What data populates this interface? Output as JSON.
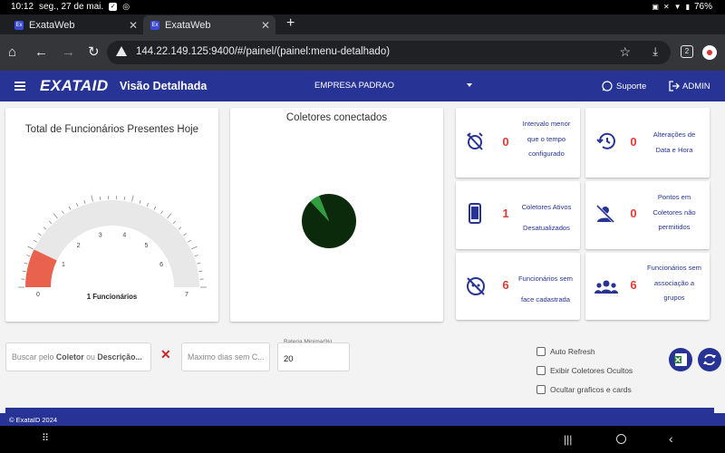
{
  "status": {
    "time": "10:12",
    "date": "seg., 27 de mai.",
    "battery": "76%"
  },
  "tabs": [
    {
      "label": "ExataWeb",
      "favicon": "Ex"
    },
    {
      "label": "ExataWeb",
      "favicon": "Ex"
    }
  ],
  "browser": {
    "url": "144.22.149.125:9400/#/painel/(painel:menu-detalhado)",
    "tab_count": "2"
  },
  "header": {
    "logo": "EXATAID",
    "title": "Visão Detalhada",
    "company": "EMPRESA PADRAO",
    "support_label": "Suporte",
    "admin_label": "ADMIN"
  },
  "gauge": {
    "title": "Total de Funcionários Presentes Hoje",
    "value_label": "1 Funcionários",
    "value": 1,
    "min": 0,
    "max": 7,
    "ticks": [
      "0",
      "1",
      "2",
      "3",
      "4",
      "5",
      "6",
      "7"
    ],
    "fill_color": "#e8624e",
    "track_color": "#e8e8e8"
  },
  "pie": {
    "title": "Coletores conectados",
    "slices": [
      {
        "value": 0.94,
        "color": "#0b2a0b"
      },
      {
        "value": 0.06,
        "color": "#2e9e3e"
      }
    ]
  },
  "stats": [
    {
      "value": "0",
      "label_lines": [
        "Intervalo menor",
        "que o tempo",
        "configurado"
      ],
      "icon": "alarm-off-icon"
    },
    {
      "value": "0",
      "label_lines": [
        "Alterações de",
        "Data e Hora"
      ],
      "icon": "history-icon"
    },
    {
      "value": "1",
      "label_lines": [
        "Coletores Ativos",
        "Desatualizados"
      ],
      "icon": "phone-device-icon"
    },
    {
      "value": "0",
      "label_lines": [
        "Pontos em",
        "Coletores não",
        "permitidos"
      ],
      "icon": "person-off-icon"
    },
    {
      "value": "6",
      "label_lines": [
        "Funcionários sem",
        "face cadastrada"
      ],
      "icon": "face-off-icon"
    },
    {
      "value": "6",
      "label_lines": [
        "Funcionários sem",
        "associação a",
        "grupos"
      ],
      "icon": "groups-icon"
    }
  ],
  "filters": {
    "search_prefix": "Buscar pelo ",
    "search_b1": "Coletor",
    "search_mid": " ou ",
    "search_b2": "Descrição...",
    "max_days_placeholder": "Maximo dias sem C...",
    "battery_label": "Bateria Minima(%)",
    "battery_value": "20"
  },
  "options": [
    "Auto Refresh",
    "Exibir Coletores Ocultos",
    "Ocultar graficos e cards"
  ],
  "footer": "© ExataID 2024"
}
